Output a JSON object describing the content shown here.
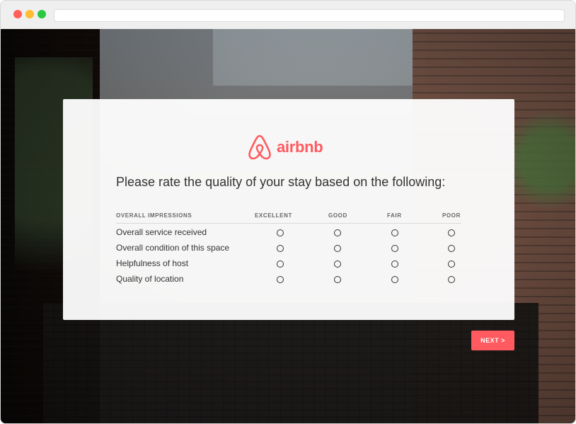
{
  "brand": {
    "name": "airbnb",
    "color": "#ff5a5f",
    "logo_icon": "airbnb-belo-icon"
  },
  "survey": {
    "question": "Please rate the quality of your stay based on the following:",
    "columns": [
      "OVERALL IMPRESSIONS",
      "EXCELLENT",
      "GOOD",
      "FAIR",
      "POOR"
    ],
    "rows": [
      "Overall service received",
      "Overall condition of this space",
      "Helpfulness of host",
      "Quality of location"
    ]
  },
  "next_button": {
    "label": "NEXT >"
  }
}
